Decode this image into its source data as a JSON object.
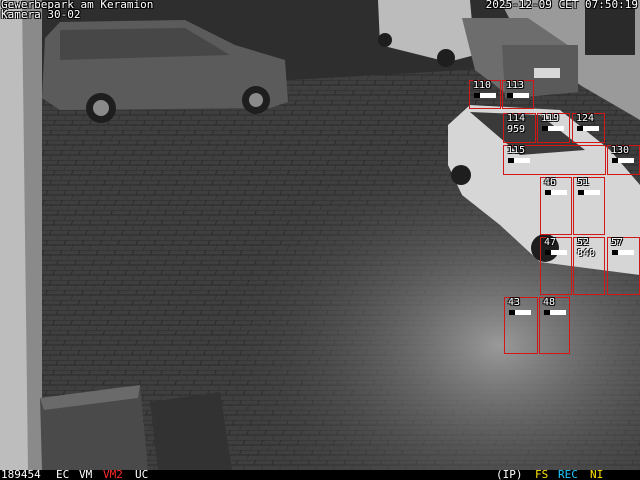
{
  "camera": {
    "title_line1": "Gewerbepark am Keramion",
    "title_line2": "Kamera 30-02",
    "timestamp": "2025-12-09 CET 07:50:19"
  },
  "status_bar": {
    "frame_number": "189454",
    "flag_ec": "EC",
    "flag_vm": "VM",
    "flag_vm2": "VM2",
    "flag_uc": "UC",
    "flag_ip": "(IP)",
    "flag_fs": "FS",
    "flag_rec": "REC",
    "flag_ni": "NI",
    "colors": {
      "white": "#ffffff",
      "vm2": "#ff2a2a",
      "fs": "#ffe000",
      "rec": "#1ec8ff",
      "ni": "#ffe000"
    }
  },
  "zones": [
    {
      "id": "110"
    },
    {
      "id": "113"
    },
    {
      "id": "114",
      "sub": "959"
    },
    {
      "id": "119"
    },
    {
      "id": "124"
    },
    {
      "id": "115"
    },
    {
      "id": "130"
    },
    {
      "id": "46"
    },
    {
      "id": "51"
    },
    {
      "id": "47"
    },
    {
      "id": "52",
      "sub": "840"
    },
    {
      "id": "57"
    },
    {
      "id": "43"
    },
    {
      "id": "48"
    }
  ],
  "zone_color": "#d01818"
}
